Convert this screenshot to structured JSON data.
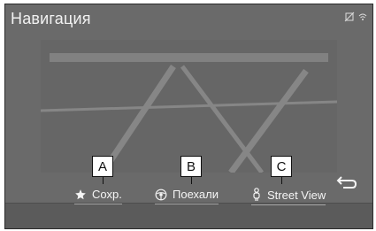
{
  "header": {
    "title": "Навигация",
    "status_icons": [
      "no-signal-icon",
      "wifi-icon"
    ]
  },
  "actions": [
    {
      "id": "save",
      "label": "Сохр.",
      "icon": "star-icon",
      "callout": "A"
    },
    {
      "id": "go",
      "label": "Поехали",
      "icon": "steering-wheel-icon",
      "callout": "B"
    },
    {
      "id": "street_view",
      "label": "Street View",
      "icon": "pegman-icon",
      "callout": "C"
    }
  ],
  "back_button": {
    "icon": "back-arrow-icon"
  },
  "colors": {
    "screen_bg": "#6a6a6a",
    "bar_bg": "#5b5b5b",
    "text": "#f2f2f2",
    "callout_border": "#111111"
  }
}
